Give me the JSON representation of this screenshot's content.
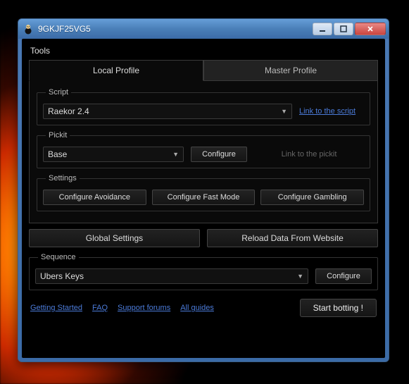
{
  "window": {
    "title": "9GKJF25VG5"
  },
  "menubar": {
    "tools": "Tools"
  },
  "tabs": {
    "local": "Local Profile",
    "master": "Master Profile"
  },
  "script": {
    "legend": "Script",
    "selected": "Raekor 2.4",
    "link": "Link to the script"
  },
  "pickit": {
    "legend": "Pickit",
    "selected": "Base",
    "configure": "Configure",
    "link": "Link to the pickit"
  },
  "settings": {
    "legend": "Settings",
    "avoidance": "Configure Avoidance",
    "fastmode": "Configure Fast Mode",
    "gambling": "Configure Gambling"
  },
  "global": {
    "globalSettings": "Global Settings",
    "reload": "Reload Data From Website"
  },
  "sequence": {
    "legend": "Sequence",
    "selected": "Ubers Keys",
    "configure": "Configure"
  },
  "footer": {
    "gettingStarted": "Getting Started",
    "faq": "FAQ",
    "supportForums": "Support forums",
    "allGuides": "All guides",
    "start": "Start botting !"
  }
}
